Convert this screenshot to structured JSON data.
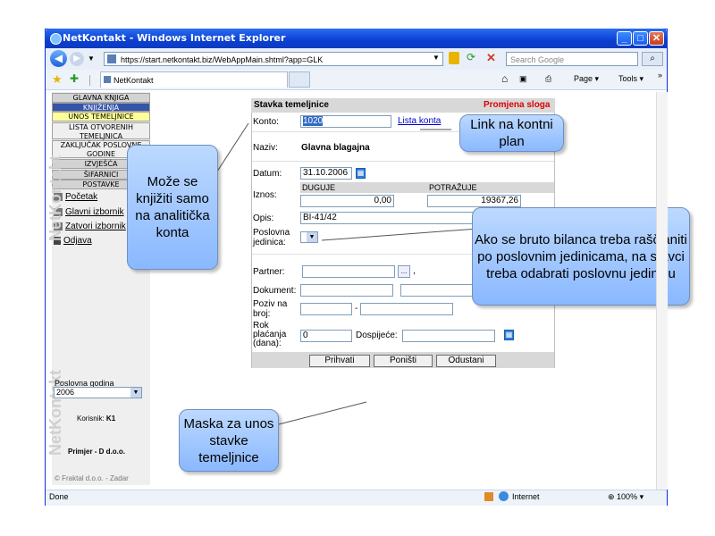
{
  "window": {
    "title": "NetKontakt - Windows Internet Explorer",
    "url": "https://start.netkontakt.biz/WebAppMain.shtml?app=GLK",
    "search_placeholder": "Search Google",
    "tab_label": "NetKontakt",
    "cmd_page": "Page",
    "cmd_tools": "Tools",
    "status_left": "Done",
    "status_zone": "Internet",
    "zoom": "100%"
  },
  "sidebar": {
    "menu": [
      {
        "label": "GLAVNA KNJIGA",
        "bg": "#d3d3d3"
      },
      {
        "label": "KNJIŽENJA",
        "bg": "#3355aa"
      },
      {
        "label": "UNOS TEMELJNICE",
        "bg": "#ffff99"
      },
      {
        "label": "LISTA OTVORENIH TEMELJNICA",
        "bg": "#efefef"
      },
      {
        "label": "ZAKLJUČAK POSLOVNE GODINE",
        "bg": "#efefef"
      },
      {
        "label": "IZVJEŠĆA",
        "bg": "#d3d3d3"
      },
      {
        "label": "ŠIFARNICI",
        "bg": "#d3d3d3"
      },
      {
        "label": "POSTAVKE",
        "bg": "#d3d3d3"
      }
    ],
    "links": [
      "Početak",
      "Glavni izbornik",
      "Zatvori izbornik",
      "Odjava"
    ],
    "year_label": "Poslovna godina",
    "year_value": "2006",
    "user_label": "Korisnik:",
    "user_value": "K1",
    "company": "Primjer - D d.o.o.",
    "footer": "© Fraktal d.o.o. - Zadar",
    "watermark": "NetKontakt"
  },
  "form": {
    "title": "Stavka temeljnice",
    "mode": "Promjena sloga",
    "konto_label": "Konto:",
    "konto_value": "1020",
    "konto_link": "Lista konta",
    "naziv_label": "Naziv:",
    "naziv_value": "Glavna blagajna",
    "datum_label": "Datum:",
    "datum_value": "31.10.2006",
    "iznos_label": "Iznos:",
    "duguje_label": "DUGUJE",
    "potrazuje_label": "POTRAŽUJE",
    "duguje_value": "0,00",
    "potrazuje_value": "19367,26",
    "opis_label": "Opis:",
    "opis_value": "BI-41/42",
    "jedinica_label": "Poslovna jedinica:",
    "partner_label": "Partner:",
    "partner_dots": "...",
    "dokument_label": "Dokument:",
    "poziv_label": "Poziv na broj:",
    "poziv_sep": "-",
    "rok_label": "Rok plaćanja (dana):",
    "rok_value": "0",
    "dospijece_label": "Dospijeće:",
    "btn_save": "Prihvati",
    "btn_reset": "Poništi",
    "btn_cancel": "Odustani"
  },
  "callouts": {
    "link": "Link na kontni plan",
    "analitika": "Može se knjižiti samo na analitička konta",
    "jedinica": "Ako se bruto bilanca treba raščlaniti po poslovnim jedinicama, na stavci treba odabrati poslovnu jedinicu",
    "maska": "Maska za unos stavke temeljnice"
  }
}
